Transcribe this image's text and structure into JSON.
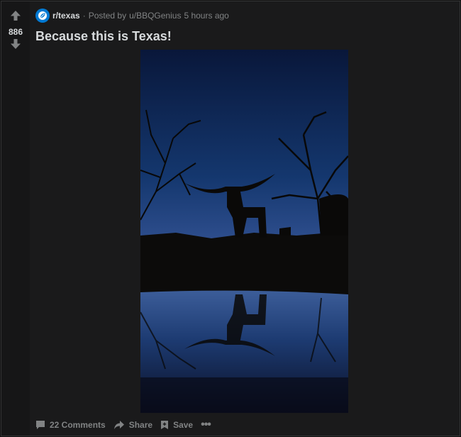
{
  "post": {
    "subreddit": "r/texas",
    "separator": "·",
    "posted_by_prefix": "Posted by",
    "author": "u/BBQGenius",
    "time_ago": "5 hours ago",
    "title": "Because this is Texas!",
    "score": "886"
  },
  "actions": {
    "comments_label": "22 Comments",
    "share_label": "Share",
    "save_label": "Save",
    "more_label": "•••"
  },
  "colors": {
    "background": "#1a1a1b",
    "text_primary": "#d7dadc",
    "text_muted": "#818384",
    "subreddit_icon_bg": "#0079d3"
  }
}
